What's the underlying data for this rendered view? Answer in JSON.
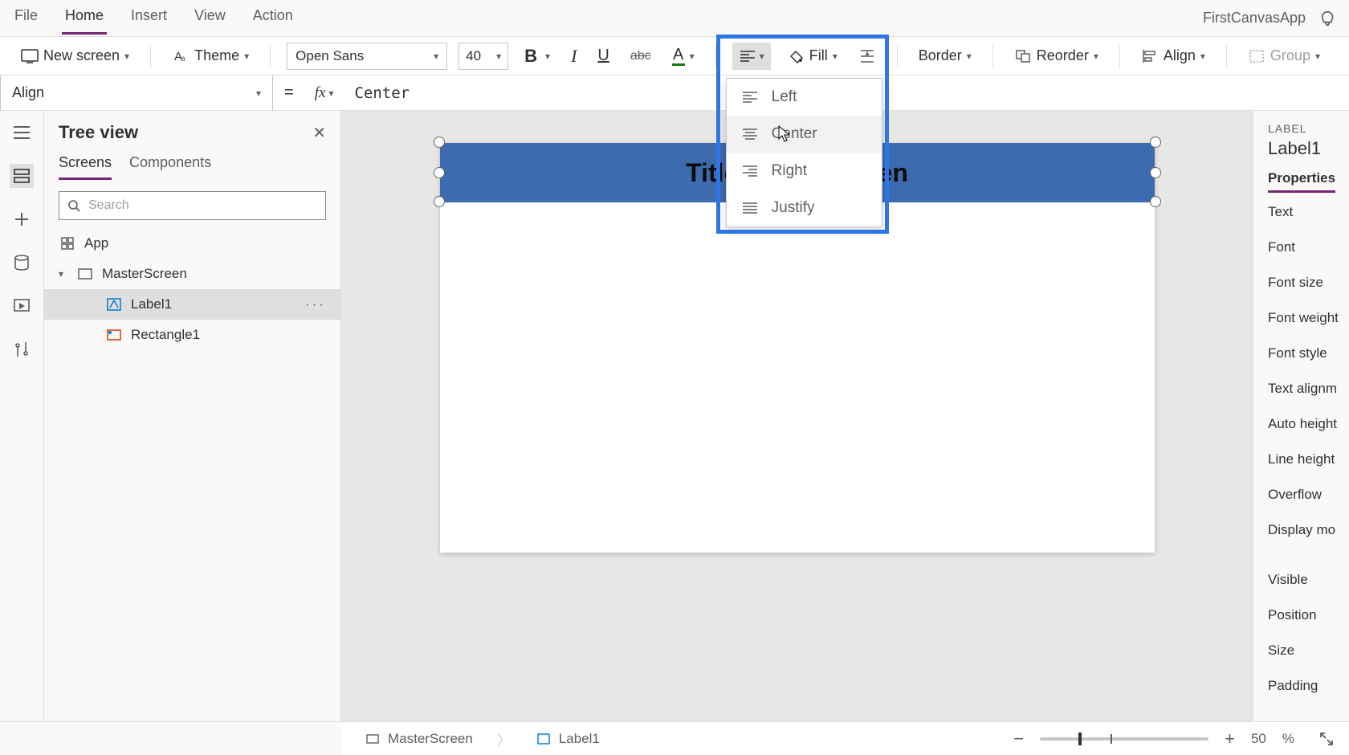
{
  "menu": {
    "items": [
      "File",
      "Home",
      "Insert",
      "View",
      "Action"
    ],
    "active": "Home",
    "appname": "FirstCanvasApp"
  },
  "ribbon": {
    "newscreen": "New screen",
    "theme": "Theme",
    "font_name": "Open Sans",
    "font_size": "40",
    "fill": "Fill",
    "border": "Border",
    "reorder": "Reorder",
    "align": "Align",
    "group": "Group"
  },
  "alignmenu": {
    "items": [
      "Left",
      "Center",
      "Right",
      "Justify"
    ],
    "hovered": "Center"
  },
  "formula": {
    "property": "Align",
    "value": "Center"
  },
  "treeview": {
    "title": "Tree view",
    "tabs": [
      "Screens",
      "Components"
    ],
    "active_tab": "Screens",
    "search_placeholder": "Search",
    "app": "App",
    "screen": "MasterScreen",
    "items": [
      {
        "name": "Label1",
        "selected": true
      },
      {
        "name": "Rectangle1",
        "selected": false
      }
    ]
  },
  "canvas": {
    "title_text": "Title of the Screen"
  },
  "props": {
    "type": "LABEL",
    "name": "Label1",
    "tab": "Properties",
    "rows": [
      "Text",
      "Font",
      "Font size",
      "Font weight",
      "Font style",
      "Text alignm",
      "Auto height",
      "Line height",
      "Overflow",
      "Display mo",
      "Visible",
      "Position",
      "Size",
      "Padding"
    ]
  },
  "status": {
    "crumbs": [
      "MasterScreen",
      "Label1"
    ],
    "zoom_value": "50",
    "zoom_unit": "%"
  }
}
